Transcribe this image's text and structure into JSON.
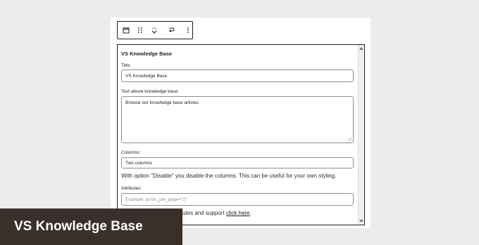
{
  "toolbar": {
    "icons": [
      "calendar-icon",
      "drag-handle-icon",
      "move-up-icon",
      "move-down-icon",
      "transform-icon",
      "more-options-icon"
    ]
  },
  "block": {
    "title": "VS Knowledge Base",
    "fields": {
      "title_label": "Title:",
      "title_value": "VS Knowledge Base",
      "text_above_label": "Text above knowledge base:",
      "text_above_value": "Browse our knowledge base articles",
      "columns_label": "Columns:",
      "columns_value": "Two columns",
      "columns_help": "With option \"Disable\" you disable the columns. This can be useful for your own styling.",
      "attributes_label": "Attributes:",
      "attributes_placeholder": "Example: posts_per_page=\"2\"",
      "attributes_help_prefix": "utes and support",
      "attributes_help_link": "click here",
      "attributes_help_suffix": "."
    }
  },
  "overlay": {
    "caption": "VS Knowledge Base"
  },
  "colors": {
    "overlay_bg": "#3a302b",
    "border": "#1e1e1e",
    "input_border": "#8c8f94",
    "background": "#ececec"
  }
}
